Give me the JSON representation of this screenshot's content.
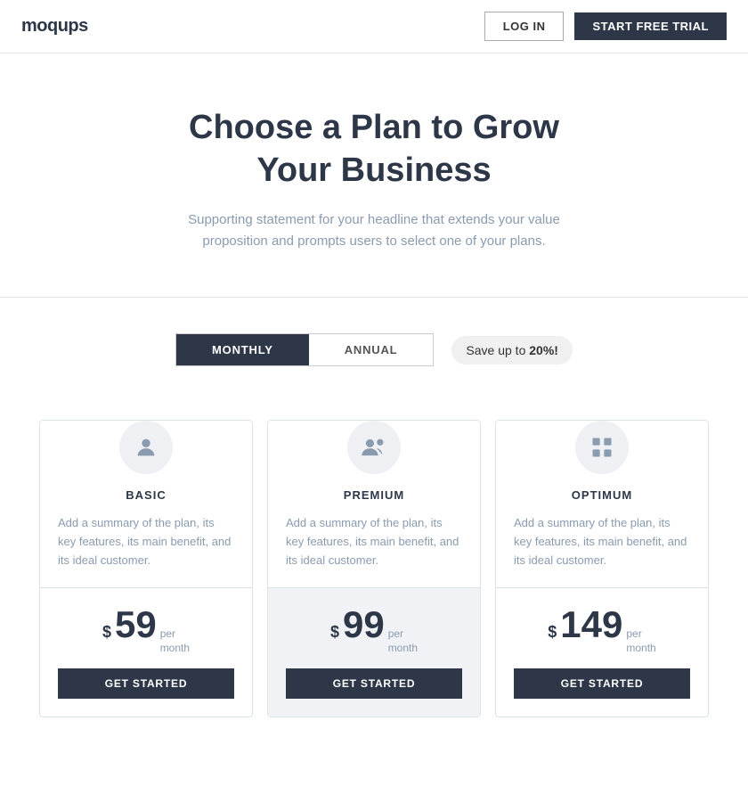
{
  "header": {
    "logo": "moqups",
    "login_label": "LOG IN",
    "trial_label": "START FREE TRIAL"
  },
  "hero": {
    "title": "Choose a Plan to Grow Your Business",
    "subtitle": "Supporting statement for your headline that extends your value proposition and prompts users to select one of your plans."
  },
  "billing": {
    "monthly_label": "MONTHLY",
    "annual_label": "ANNUAL",
    "save_badge": "Save up to ",
    "save_amount": "20%!",
    "active": "monthly"
  },
  "plans": [
    {
      "id": "basic",
      "name": "BASIC",
      "icon": "single-user",
      "description": "Add a summary of the plan, its key features, its main benefit, and its ideal customer.",
      "price_dollar": "$",
      "price_amount": "59",
      "price_per": "per",
      "price_period": "month",
      "cta": "GET STARTED",
      "highlighted": false
    },
    {
      "id": "premium",
      "name": "PREMIUM",
      "icon": "multi-user",
      "description": "Add a summary of the plan, its key features, its main benefit, and its ideal customer.",
      "price_dollar": "$",
      "price_amount": "99",
      "price_per": "per",
      "price_period": "month",
      "cta": "GET STARTED",
      "highlighted": true
    },
    {
      "id": "optimum",
      "name": "OPTIMUM",
      "icon": "grid",
      "description": "Add a summary of the plan, its key features, its main benefit, and its ideal customer.",
      "price_dollar": "$",
      "price_amount": "149",
      "price_per": "per",
      "price_period": "month",
      "cta": "GET STARTED",
      "highlighted": false
    }
  ]
}
